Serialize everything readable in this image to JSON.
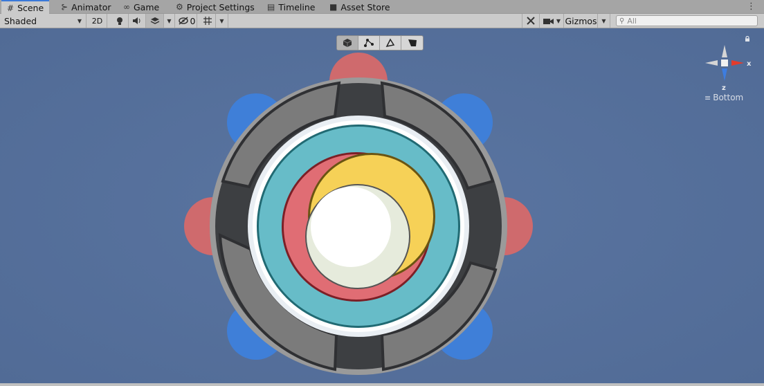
{
  "tabs": [
    {
      "label": "Scene",
      "icon": "grid-icon",
      "active": true
    },
    {
      "label": "Animator",
      "icon": "animator-icon"
    },
    {
      "label": "Game",
      "icon": "gamepad-icon"
    },
    {
      "label": "Project Settings",
      "icon": "gear-icon"
    },
    {
      "label": "Timeline",
      "icon": "timeline-icon"
    },
    {
      "label": "Asset Store",
      "icon": "shopping-bag-icon"
    }
  ],
  "toolbar": {
    "draw_mode": "Shaded",
    "mode_2d": "2D",
    "hidden_count": "0",
    "gizmos": "Gizmos",
    "search_placeholder": "All"
  },
  "orientation": {
    "view_label": "Bottom",
    "axis_x": "x",
    "axis_z": "z"
  },
  "colors": {
    "scene_bg": "#55709b",
    "accent_tab": "#3a79d9",
    "ring_teal": "#67bcc8",
    "ring_red": "#e06d74",
    "ring_yellow": "#f6d157",
    "core_white": "#ffffff",
    "lobe_blue": "#3f7fd8",
    "lobe_red": "#d86b6d"
  }
}
